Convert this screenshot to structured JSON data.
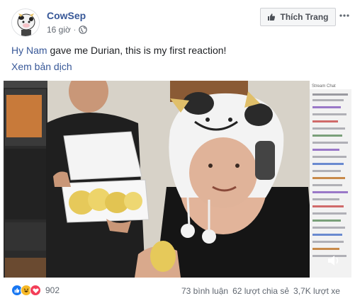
{
  "post": {
    "author": "CowSep",
    "time": "16 giờ",
    "separator": "·",
    "like_page_label": "Thích Trang",
    "caption_tag": "Hy Nam",
    "caption_text": " gave me Durian, this is my first reaction!",
    "translate_label": "Xem bản dịch"
  },
  "stream_chat": {
    "title": "Stream Chat"
  },
  "footer": {
    "reaction_count": "902",
    "comments": "73 bình luận",
    "shares": "62 lượt chia sẻ",
    "views": "3,7K lượt xe"
  },
  "icons": {
    "globe": "globe-icon",
    "like": "thumbs-up-icon",
    "haha": "haha-icon",
    "love": "heart-icon",
    "more": "more-icon"
  },
  "colors": {
    "link": "#385898",
    "like_blue": "#1877f2",
    "haha_yellow": "#f7b928",
    "love_red": "#f33e58"
  }
}
